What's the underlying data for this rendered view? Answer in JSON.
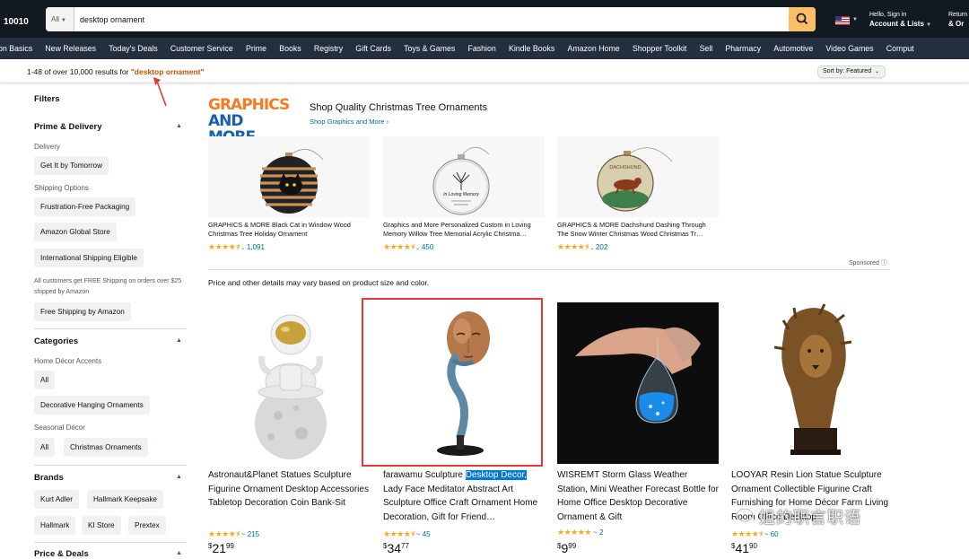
{
  "header": {
    "zip": "10010",
    "search_category": "All",
    "search_value": "desktop ornament",
    "account_line1": "Hello, Sign in",
    "account_line2": "Account & Lists",
    "returns_line1": "Return",
    "returns_line2": "& Or"
  },
  "nav": [
    "on Basics",
    "New Releases",
    "Today's Deals",
    "Customer Service",
    "Prime",
    "Books",
    "Registry",
    "Gift Cards",
    "Toys & Games",
    "Fashion",
    "Kindle Books",
    "Amazon Home",
    "Shopper Toolkit",
    "Sell",
    "Pharmacy",
    "Automotive",
    "Video Games",
    "Comput"
  ],
  "results": {
    "count_text": "1-48 of over 10,000 results for ",
    "query": "\"desktop ornament\"",
    "sort_label": "Sort by: Featured"
  },
  "sidebar": {
    "filters": "Filters",
    "prime_heading": "Prime & Delivery",
    "delivery_label": "Delivery",
    "get_it_tomorrow": "Get It by Tomorrow",
    "shipping_label": "Shipping Options",
    "frustration_free": "Frustration-Free Packaging",
    "global_store": "Amazon Global Store",
    "intl_shipping": "International Shipping Eligible",
    "free_ship_note": "All customers get FREE Shipping on orders over $25 shipped by Amazon",
    "free_ship_chip": "Free Shipping by Amazon",
    "categories_heading": "Categories",
    "home_decor_label": "Home Décor Accents",
    "all_1": "All",
    "hanging_ornaments": "Decorative Hanging Ornaments",
    "seasonal_label": "Seasonal Décor",
    "all_2": "All",
    "christmas_ornaments": "Christmas Ornaments",
    "brands_heading": "Brands",
    "brand_kurt": "Kurt Adler",
    "brand_hallmark_keepsake": "Hallmark Keepsake",
    "brand_hallmark": "Hallmark",
    "brand_ki": "KI Store",
    "brand_prextex": "Prextex",
    "price_heading": "Price & Deals"
  },
  "sponsored": {
    "logo_line1": "GRAPHICS",
    "logo_line2": "AND MORE",
    "title": "Shop Quality Christmas Tree Ornaments",
    "link": "Shop Graphics and More ›",
    "items": [
      {
        "title": "GRAPHICS & MORE Black Cat in Window Wood Christmas Tree Holiday Ornament",
        "rating": 4.5,
        "count": "1,091"
      },
      {
        "title": "Graphics and More Personalized Custom in Loving Memory Willow Tree Memorial Acrylic Christma…",
        "rating": 4.5,
        "count": "450"
      },
      {
        "title": "GRAPHICS & MORE Dachshund Dashing Through The Snow Winter Christmas Wood Christmas Tr…",
        "rating": 4.5,
        "count": "202"
      }
    ],
    "sponsored_label": "Sponsored ⓘ",
    "ornament3_text": "DACHSHUND",
    "ornament2_text": "In Loving Memory"
  },
  "price_note": "Price and other details may vary based on product size and color.",
  "products": [
    {
      "title_pre": "Astronaut&Planet Statues Sculpture Figurine Ornament Desktop Accessories Tabletop Decoration Coin Bank-Sit",
      "title_hl": "",
      "title_post": "",
      "rating": 4.5,
      "count": "215",
      "price_whole": "21",
      "price_frac": "99"
    },
    {
      "title_pre": "farawamu Sculpture ",
      "title_hl": "Desktop Decor,",
      "title_post": " Lady Face Meditator Abstract Art Sculpture Office Craft Ornament Home Decoration, Gift for Friend…",
      "rating": 4.5,
      "count": "45",
      "price_whole": "34",
      "price_frac": "77"
    },
    {
      "title_pre": "WISREMT Storm Glass Weather Station, Mini Weather Forecast Bottle for Home Office Desktop Decorative Ornament & Gift",
      "title_hl": "",
      "title_post": "",
      "rating": 5,
      "count": "2",
      "price_whole": "9",
      "price_frac": "99"
    },
    {
      "title_pre": "LOOYAR Resin Lion Statue Sculpture Ornament Collectible Figurine Craft Furnishing for Home Décor Farm Living Room Office Desktop",
      "title_hl": "",
      "title_post": "",
      "rating": 4.5,
      "count": "60",
      "price_whole": "41",
      "price_frac": "90"
    }
  ],
  "rating_prefix": "~ ",
  "currency": "$",
  "watermark": "姐的职言职语",
  "colors": {
    "top_bar": "#131921",
    "nav_bar": "#232f3e",
    "search_button": "#febd69",
    "link": "#007185",
    "star": "#ffa41c",
    "query": "#c45500",
    "highlight": "#0078d7",
    "annotation_red": "#e53935"
  }
}
